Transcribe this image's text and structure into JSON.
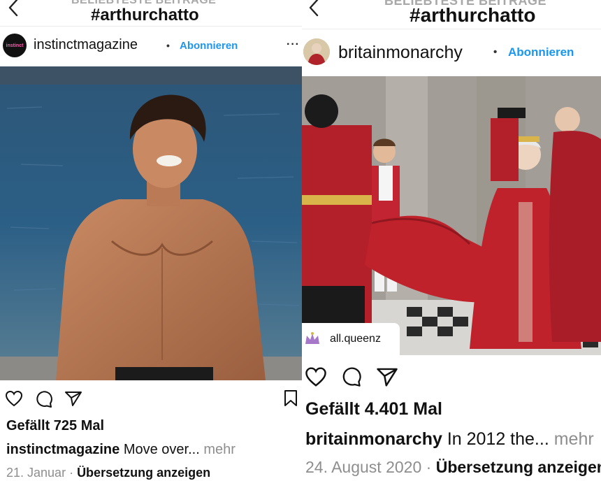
{
  "header": {
    "subtitle": "BELIEBTESTE BEITRÄGE",
    "hashtag": "#arthurchatto",
    "back_icon": "chevron-left-icon"
  },
  "posts": [
    {
      "username": "instinctmagazine",
      "avatar_text": "instinct",
      "separator": "•",
      "follow_label": "Abonnieren",
      "more_label": "···",
      "likes": "Gefällt 725 Mal",
      "caption_user": "instinctmagazine",
      "caption_text": " Move over...",
      "more_text": " mehr",
      "date": "21. Januar",
      "meta_sep": " · ",
      "translate_label": "Übersetzung anzeigen",
      "icons": [
        "heart-icon",
        "comment-icon",
        "share-icon",
        "bookmark-icon"
      ]
    },
    {
      "username": "britainmonarchy",
      "separator": "•",
      "follow_label": "Abonnieren",
      "tagged_user": "all.queenz",
      "likes": "Gefällt 4.401 Mal",
      "caption_user": "britainmonarchy",
      "caption_text": " In 2012 the...",
      "more_text": " mehr",
      "date": "24. August 2020",
      "meta_sep": " · ",
      "translate_label": "Übersetzung anzeigen",
      "icons": [
        "heart-icon",
        "comment-icon",
        "share-icon"
      ]
    }
  ],
  "colors": {
    "follow_blue": "#1c96ee",
    "muted_gray": "#8e8e8e",
    "royal_red": "#c0222c"
  }
}
